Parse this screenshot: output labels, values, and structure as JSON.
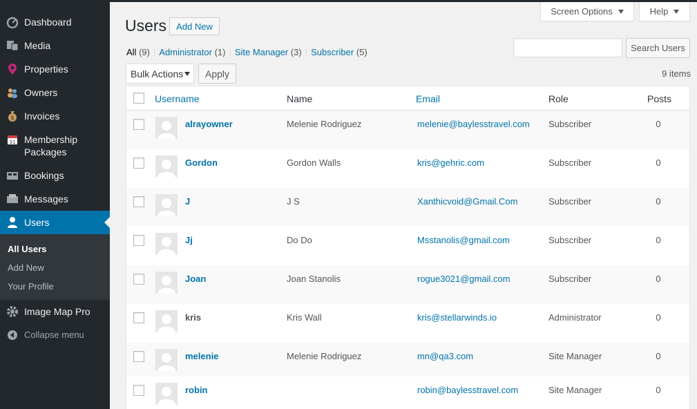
{
  "sidebar": {
    "items": [
      {
        "label": "Dashboard",
        "icon": "dashboard-icon"
      },
      {
        "label": "Media",
        "icon": "media-icon"
      },
      {
        "label": "Properties",
        "icon": "location-pin-icon"
      },
      {
        "label": "Owners",
        "icon": "people-icon"
      },
      {
        "label": "Invoices",
        "icon": "money-bag-icon"
      },
      {
        "label": "Membership Packages",
        "icon": "calendar-icon"
      },
      {
        "label": "Bookings",
        "icon": "bookings-icon"
      },
      {
        "label": "Messages",
        "icon": "messages-icon"
      },
      {
        "label": "Users",
        "icon": "user-icon"
      }
    ],
    "submenu": [
      "All Users",
      "Add New",
      "Your Profile"
    ],
    "bottom_items": [
      {
        "label": "Image Map Pro",
        "icon": "gear-icon"
      },
      {
        "label": "Collapse menu",
        "icon": "collapse-icon"
      }
    ]
  },
  "screen_meta": {
    "screen_options": "Screen Options",
    "help": "Help"
  },
  "page": {
    "title": "Users",
    "add_new": "Add New"
  },
  "filters": [
    {
      "label": "All",
      "count": "(9)"
    },
    {
      "label": "Administrator",
      "count": "(1)"
    },
    {
      "label": "Site Manager",
      "count": "(3)"
    },
    {
      "label": "Subscriber",
      "count": "(5)"
    }
  ],
  "search": {
    "button": "Search Users",
    "value": ""
  },
  "bulk": {
    "selected": "Bulk Actions",
    "apply": "Apply",
    "items_count": "9 items"
  },
  "table": {
    "columns": {
      "username": "Username",
      "name": "Name",
      "email": "Email",
      "role": "Role",
      "posts": "Posts"
    },
    "rows": [
      {
        "username": "alrayowner",
        "name": "Melenie Rodriguez",
        "email": "melenie@baylesstravel.com",
        "role": "Subscriber",
        "posts": "0"
      },
      {
        "username": "Gordon",
        "name": "Gordon Walls",
        "email": "kris@gehric.com",
        "role": "Subscriber",
        "posts": "0"
      },
      {
        "username": "J",
        "name": "J S",
        "email": "Xanthicvoid@Gmail.Com",
        "role": "Subscriber",
        "posts": "0"
      },
      {
        "username": "Jj",
        "name": "Do Do",
        "email": "Msstanolis@gmail.com",
        "role": "Subscriber",
        "posts": "0"
      },
      {
        "username": "Joan",
        "name": "Joan Stanolis",
        "email": "rogue3021@gmail.com",
        "role": "Subscriber",
        "posts": "0"
      },
      {
        "username": "kris",
        "name": "Kris Wall",
        "email": "kris@stellarwinds.io",
        "role": "Administrator",
        "posts": "0"
      },
      {
        "username": "melenie",
        "name": "Melenie Rodriguez",
        "email": "mn@qa3.com",
        "role": "Site Manager",
        "posts": "0"
      },
      {
        "username": "robin",
        "name": "",
        "email": "robin@baylesstravel.com",
        "role": "Site Manager",
        "posts": "0"
      }
    ]
  }
}
